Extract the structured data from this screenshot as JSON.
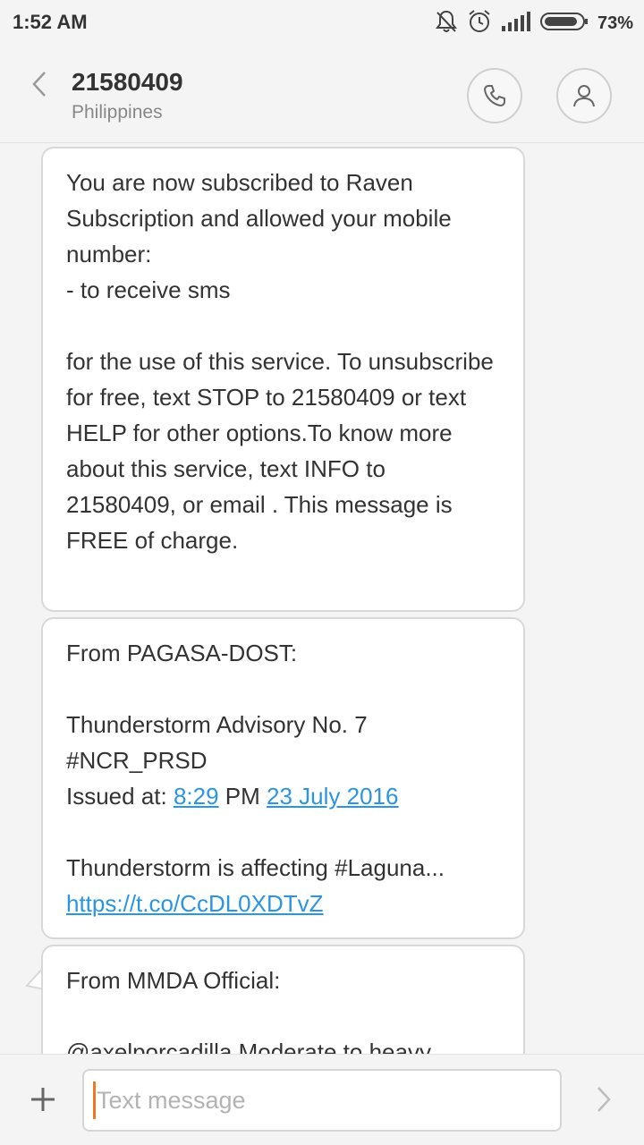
{
  "status_bar": {
    "time": "1:52 AM",
    "battery_percent": "73%",
    "icons": [
      "bell-off-icon",
      "alarm-icon",
      "signal-icon",
      "battery-icon"
    ]
  },
  "header": {
    "contact_number": "21580409",
    "contact_location": "Philippines"
  },
  "messages": [
    {
      "text": "You are now subscribed to Raven Subscription and allowed your mobile number:\n- to receive sms\n\nfor the use of this service. To unsubscribe for free, text STOP to 21580409 or text HELP for other options.To know more about this service, text INFO to 21580409, or email . This message is FREE of charge."
    },
    {
      "line1": "From PAGASA-DOST:",
      "line2": "Thunderstorm Advisory No. 7",
      "line3": "#NCR_PRSD",
      "issued_prefix": "Issued at: ",
      "issued_time": "8:29",
      "issued_mid": " PM ",
      "issued_date": "23 July 2016",
      "line5": "Thunderstorm is affecting #Laguna...",
      "link": "https://t.co/CcDL0XDTvZ"
    },
    {
      "line1": "From MMDA Official:",
      "line2": "@axelporcadilla Moderate to heavy"
    }
  ],
  "composer": {
    "placeholder": "Text message",
    "value": ""
  },
  "colors": {
    "link": "#2a94e6",
    "cursor": "#f07a1a",
    "background": "#f4f4f4"
  }
}
